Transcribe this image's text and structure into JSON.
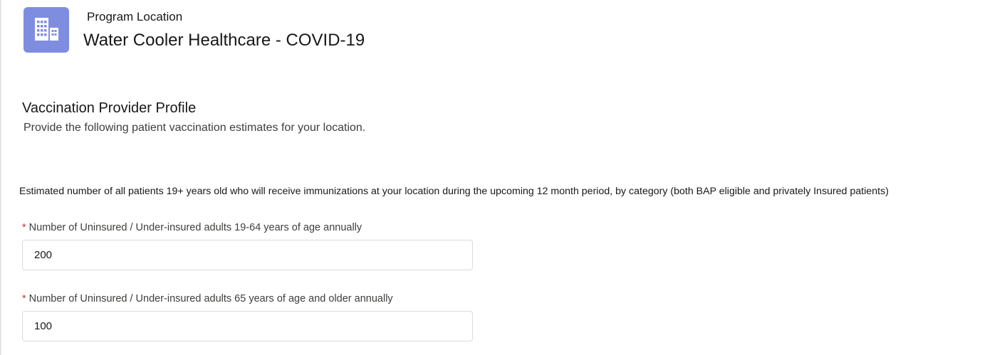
{
  "header": {
    "icon": "location-building-icon",
    "icon_color": "#7f8de1",
    "label": "Program Location",
    "title": "Water Cooler Healthcare - COVID-19"
  },
  "profile": {
    "title": "Vaccination Provider Profile",
    "description": "Provide the following patient vaccination estimates for your location."
  },
  "category_note": "Estimated number of all patients 19+ years old who will receive immunizations at your location during the upcoming 12 month period, by category (both BAP eligible and privately Insured patients)",
  "fields": [
    {
      "required_mark": "*",
      "label": "Number of Uninsured / Under-insured adults 19-64 years of age annually",
      "value": "200"
    },
    {
      "required_mark": "*",
      "label": "Number of Uninsured / Under-insured adults 65 years of age and older annually",
      "value": "100"
    }
  ],
  "colors": {
    "required": "#c23934",
    "border": "#dddbda"
  }
}
